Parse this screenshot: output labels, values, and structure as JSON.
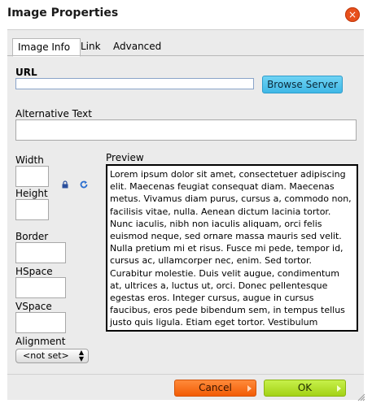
{
  "dialog": {
    "title": "Image Properties",
    "close_icon": "close-icon",
    "close_glyph": "×"
  },
  "tabs": [
    {
      "label": "Image Info",
      "active": true
    },
    {
      "label": "Link",
      "active": false
    },
    {
      "label": "Advanced",
      "active": false
    }
  ],
  "image_info": {
    "url_label": "URL",
    "url_value": "",
    "browse_label": "Browse Server",
    "alt_label": "Alternative Text",
    "alt_value": "",
    "width_label": "Width",
    "width_value": "",
    "height_label": "Height",
    "height_value": "",
    "lock_icon": "lock-icon",
    "reset_icon": "reset-size-icon",
    "border_label": "Border",
    "border_value": "",
    "hspace_label": "HSpace",
    "hspace_value": "",
    "vspace_label": "VSpace",
    "vspace_value": "",
    "alignment_label": "Alignment",
    "alignment_selected": "<not set>",
    "preview_label": "Preview",
    "preview_text": "Lorem ipsum dolor sit amet, consectetuer adipiscing elit. Maecenas feugiat consequat diam. Maecenas metus. Vivamus diam purus, cursus a, commodo non, facilisis vitae, nulla. Aenean dictum lacinia tortor. Nunc iaculis, nibh non iaculis aliquam, orci felis euismod neque, sed ornare massa mauris sed velit. Nulla pretium mi et risus. Fusce mi pede, tempor id, cursus ac, ullamcorper nec, enim. Sed tortor. Curabitur molestie. Duis velit augue, condimentum at, ultrices a, luctus ut, orci. Donec pellentesque egestas eros. Integer cursus, augue in cursus faucibus, eros pede bibendum sem, in tempus tellus justo quis ligula. Etiam eget tortor. Vestibulum rutrum, est ut placerat elementum, lectus nisl aliquam velit, tempor aliquam eros nunc nonummy metus. In eros metus, gravida a"
  },
  "footer": {
    "cancel_label": "Cancel",
    "ok_label": "OK"
  },
  "colors": {
    "close": "#e8501b",
    "browse": "#3fb8e6",
    "cancel": "#f25c05",
    "ok": "#a3d216"
  }
}
